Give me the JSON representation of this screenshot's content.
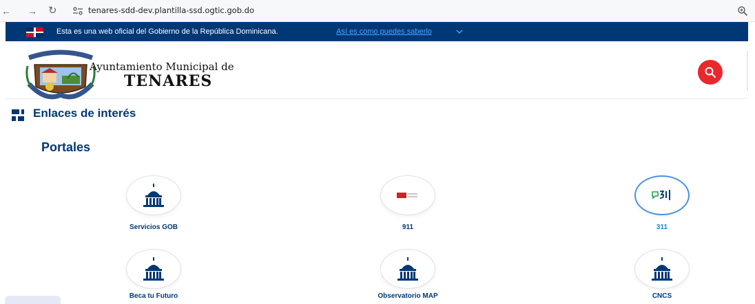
{
  "browser": {
    "back": "←",
    "forward": "→",
    "reload": "↻",
    "url": "tenares-sdd-dev.plantilla-ssd.ogtic.gob.do"
  },
  "govbar": {
    "text": "Esta es una web oficial del Gobierno de la República Dominicana.",
    "link": "Así es como puedes saberlo"
  },
  "header": {
    "line1": "Ayuntamiento Municipal de",
    "line2": "TENARES"
  },
  "section": {
    "title": "Enlaces de interés",
    "subtitle": "Portales"
  },
  "portals": [
    {
      "label": "Servicios GOB",
      "icon": "dome-icon"
    },
    {
      "label": "911",
      "icon": "911-logo-icon"
    },
    {
      "label": "311",
      "icon": "311-logo-icon",
      "active": true
    },
    {
      "label": "Beca tu Futuro",
      "icon": "dome-icon"
    },
    {
      "label": "Observatorio MAP",
      "icon": "dome-icon"
    },
    {
      "label": "CNCS",
      "icon": "dome-icon"
    }
  ],
  "colors": {
    "navy": "#003876",
    "link_blue": "#4ea3ff",
    "active_blue": "#1e7fd6",
    "search_red": "#e8282b"
  }
}
